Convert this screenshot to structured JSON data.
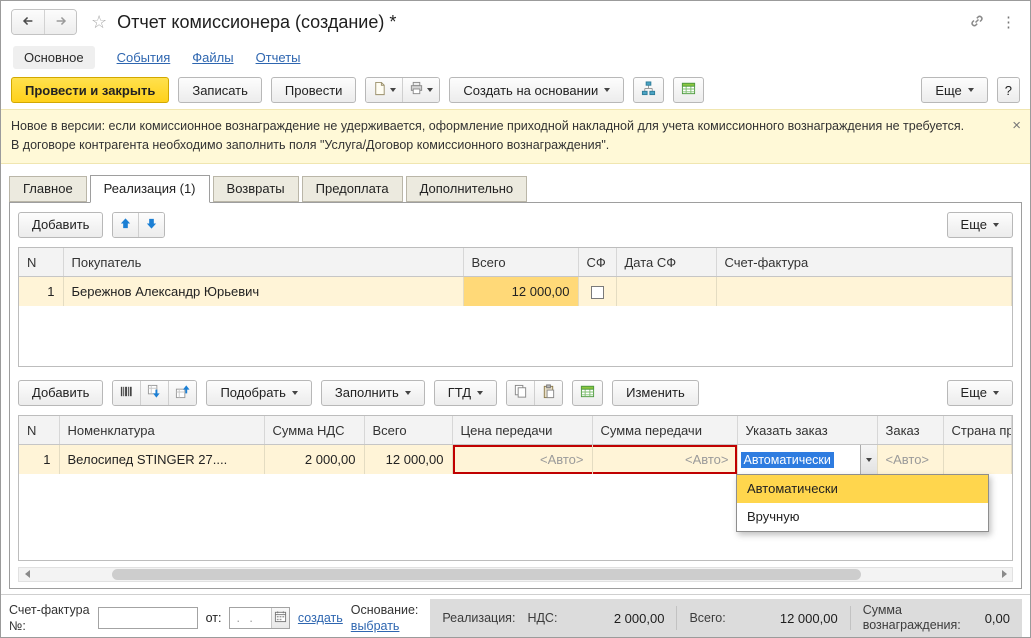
{
  "colors": {
    "accent_yellow": "#FFD11A",
    "row_highlight": "#FFF4D7",
    "total_cell": "#FFD978",
    "attention_red": "#C00000",
    "link_blue": "#2E66B0",
    "selection_blue": "#2E7CE0",
    "dropdown_highlight": "#FFD64D"
  },
  "header": {
    "title": "Отчет комиссионера (создание) *"
  },
  "nav": {
    "items": [
      {
        "label": "Основное",
        "active": true
      },
      {
        "label": "События"
      },
      {
        "label": "Файлы"
      },
      {
        "label": "Отчеты"
      }
    ]
  },
  "toolbar": {
    "post_close": "Провести и закрыть",
    "write": "Записать",
    "post": "Провести",
    "create_on_basis": "Создать на основании",
    "more": "Еще",
    "help": "?"
  },
  "banner": {
    "line1": "Новое в версии: если комиссионное вознаграждение не удерживается, оформление приходной накладной для учета комиссионного вознаграждения не требуется.",
    "line2": "В договоре контрагента необходимо заполнить поля \"Услуга/Договор комиссионного вознаграждения\"."
  },
  "tabs": [
    {
      "label": "Главное"
    },
    {
      "label": "Реализация (1)",
      "active": true
    },
    {
      "label": "Возвраты"
    },
    {
      "label": "Предоплата"
    },
    {
      "label": "Дополнительно"
    }
  ],
  "sales": {
    "add": "Добавить",
    "more": "Еще",
    "columns": {
      "n": "N",
      "buyer": "Покупатель",
      "total": "Всего",
      "sf": "СФ",
      "sf_date": "Дата СФ",
      "invoice": "Счет-фактура"
    },
    "row": {
      "n": "1",
      "buyer": "Бережнов Александр Юрьевич",
      "total": "12 000,00"
    }
  },
  "items": {
    "add": "Добавить",
    "pick": "Подобрать",
    "fill": "Заполнить",
    "gtd": "ГТД",
    "change": "Изменить",
    "more": "Еще",
    "columns": {
      "n": "N",
      "nomenclature": "Номенклатура",
      "vat": "Сумма НДС",
      "total": "Всего",
      "transfer_price": "Цена передачи",
      "transfer_sum": "Сумма передачи",
      "specify_order": "Указать заказ",
      "order": "Заказ",
      "country": "Страна про..."
    },
    "row": {
      "n": "1",
      "nomenclature": "Велосипед STINGER 27....",
      "vat": "2 000,00",
      "total": "12 000,00",
      "transfer_price": "<Авто>",
      "transfer_sum": "<Авто>",
      "specify_order": "Автоматически",
      "order": "<Авто>"
    }
  },
  "dropdown": {
    "options": [
      {
        "label": "Автоматически",
        "highlighted": true
      },
      {
        "label": "Вручную",
        "highlighted": false
      }
    ]
  },
  "footer": {
    "invoice_line1": "Счет-фактура",
    "invoice_line2": "№:",
    "from": "от:",
    "date_value": ". .",
    "create": "создать",
    "basis": "Основание:",
    "choose": "выбрать",
    "summary": {
      "realization": "Реализация:",
      "vat_label": "НДС:",
      "vat": "2 000,00",
      "total_label": "Всего:",
      "total": "12 000,00",
      "fee_label": "Сумма вознаграждения:",
      "fee": "0,00"
    }
  }
}
